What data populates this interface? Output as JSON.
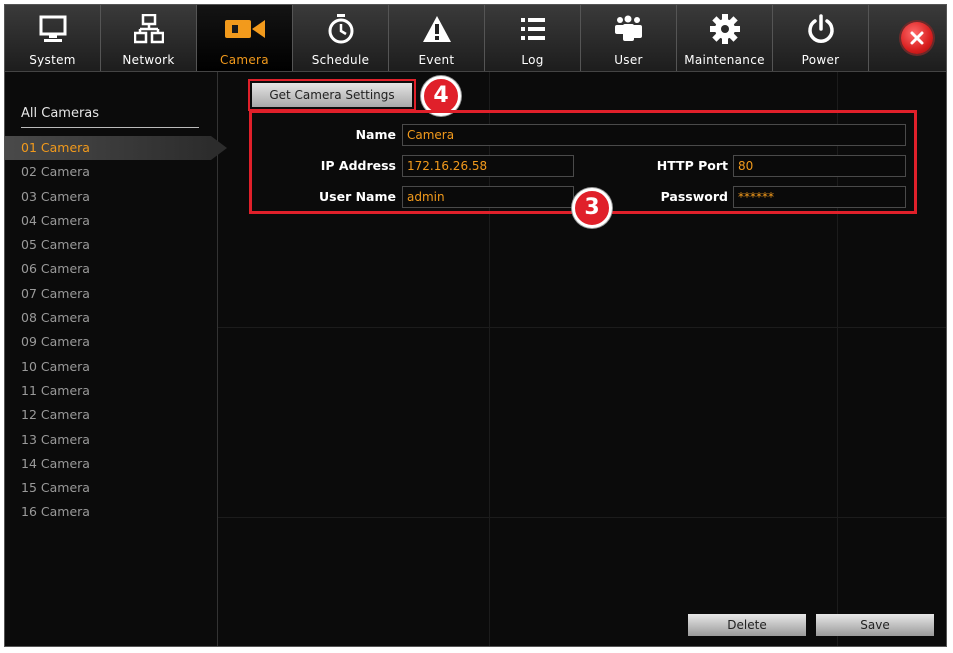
{
  "toolbar": {
    "tabs": [
      {
        "label": "System",
        "icon": "monitor-icon"
      },
      {
        "label": "Network",
        "icon": "network-icon"
      },
      {
        "label": "Camera",
        "icon": "camera-icon",
        "active": true
      },
      {
        "label": "Schedule",
        "icon": "clock-icon"
      },
      {
        "label": "Event",
        "icon": "warning-icon"
      },
      {
        "label": "Log",
        "icon": "list-icon"
      },
      {
        "label": "User",
        "icon": "users-icon"
      },
      {
        "label": "Maintenance",
        "icon": "gear-icon"
      },
      {
        "label": "Power",
        "icon": "power-icon"
      }
    ],
    "close_icon": "close-icon"
  },
  "sidebar": {
    "title": "All Cameras",
    "cameras": [
      "01 Camera",
      "02 Camera",
      "03 Camera",
      "04 Camera",
      "05 Camera",
      "06 Camera",
      "07 Camera",
      "08 Camera",
      "09 Camera",
      "10 Camera",
      "11 Camera",
      "12 Camera",
      "13 Camera",
      "14 Camera",
      "15 Camera",
      "16 Camera"
    ],
    "selected_index": 0
  },
  "main": {
    "get_settings_label": "Get Camera Settings",
    "badge_get": "4",
    "badge_form": "3",
    "form": {
      "name_label": "Name",
      "name_value": "Camera",
      "ip_label": "IP Address",
      "ip_value": "172.16.26.58",
      "port_label": "HTTP Port",
      "port_value": "80",
      "user_label": "User Name",
      "user_value": "admin",
      "pass_label": "Password",
      "pass_value": "******"
    },
    "delete_label": "Delete",
    "save_label": "Save"
  },
  "colors": {
    "accent": "#f29a1c",
    "highlight": "#e0202a",
    "background": "#0b0b0b"
  }
}
